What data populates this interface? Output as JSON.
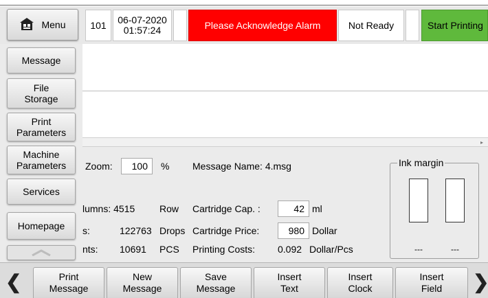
{
  "header": {
    "menu_label": "Menu",
    "line_number": "101",
    "date": "06-07-2020",
    "time": "01:57:24",
    "alarm_text": "Please Acknowledge Alarm",
    "status_text": "Not Ready",
    "start_label": "Start Printing"
  },
  "sidebar": {
    "items": [
      {
        "label": "Message"
      },
      {
        "label": "File Storage"
      },
      {
        "label": "Print Parameters"
      },
      {
        "label": "Machine Parameters"
      },
      {
        "label": "Services"
      },
      {
        "label": "Homepage"
      }
    ]
  },
  "info": {
    "zoom_label": "Zoom:",
    "zoom_value": "100",
    "zoom_unit": "%",
    "message_name": "Message Name: 4.msg",
    "columns_label": "lumns: 4515",
    "columns_unit": "Row",
    "drops_label": "s:",
    "drops_value": "122763",
    "drops_unit": "Drops",
    "prints_label": "nts:",
    "prints_value": "10691",
    "prints_unit": "PCS",
    "cartridge_cap_label": "Cartridge Cap. :",
    "cartridge_cap_value": "42",
    "cartridge_cap_unit": "ml",
    "cartridge_price_label": "Cartridge Price:",
    "cartridge_price_value": "980",
    "cartridge_price_unit": "Dollar",
    "printing_costs_label": "Printing Costs:",
    "printing_costs_value": "0.092",
    "printing_costs_unit": "Dollar/Pcs"
  },
  "ink": {
    "label": "Ink margin",
    "left_value": "---",
    "right_value": "---"
  },
  "toolbar": {
    "items": [
      {
        "label": "Print Message"
      },
      {
        "label": "New Message"
      },
      {
        "label": "Save Message"
      },
      {
        "label": "Insert Text"
      },
      {
        "label": "Insert Clock"
      },
      {
        "label": "Insert Field"
      }
    ]
  },
  "colors": {
    "alarm": "#ff0000",
    "start": "#5fb93c",
    "panel": "#ebebeb"
  },
  "icons": {
    "menu": "home-icon",
    "scroll_up": "chevron-up-icon",
    "prev": "chevron-left-icon",
    "next": "chevron-right-icon"
  }
}
